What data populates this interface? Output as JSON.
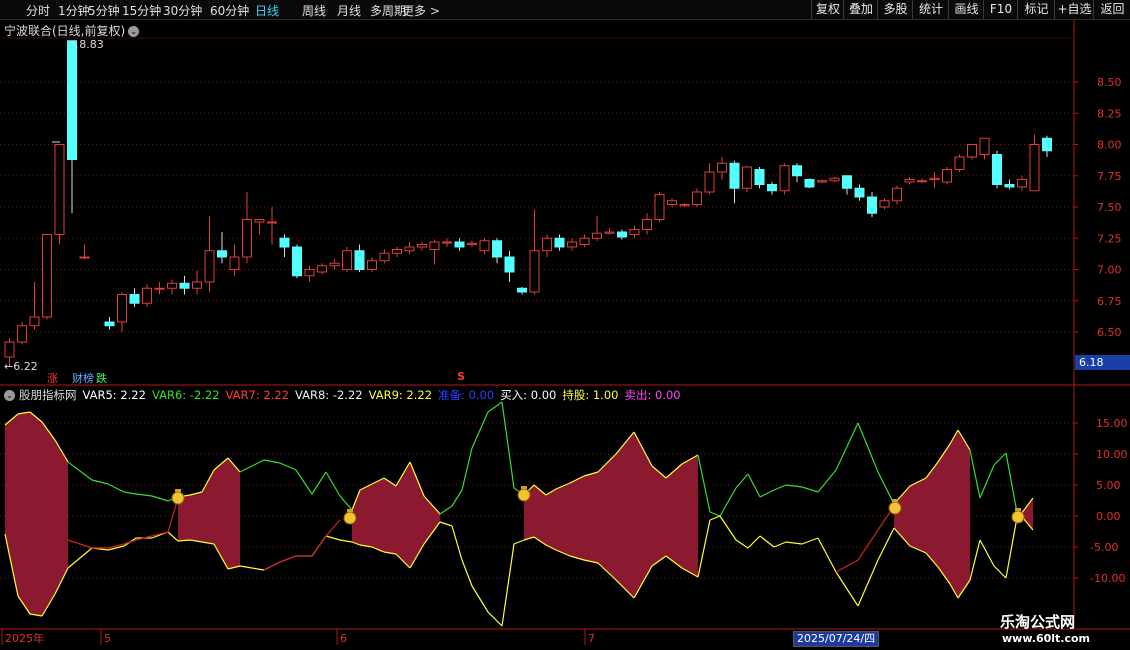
{
  "toolbar": {
    "periods": [
      "分时",
      "1分钟",
      "5分钟",
      "15分钟",
      "30分钟",
      "60分钟",
      "日线",
      "周线",
      "月线",
      "多周期",
      "更多 >"
    ],
    "active_period": "日线",
    "buttons": [
      "复权",
      "叠加",
      "多股",
      "统计",
      "画线",
      "F10",
      "标记",
      "+自选",
      "返回"
    ]
  },
  "stock": {
    "title": "宁波联合(日线,前复权)",
    "high_label": "8.83",
    "low_label": "6.22",
    "current_price": "6.18",
    "markers": {
      "zhang": "涨",
      "caibang": "财榜",
      "die": "跌",
      "s": "S"
    }
  },
  "indicator": {
    "name": "股朋指标网",
    "items": [
      {
        "label": "VAR5: 2.22",
        "color": "#ffffff"
      },
      {
        "label": "VAR6: -2.22",
        "color": "#2ee62e"
      },
      {
        "label": "VAR7: 2.22",
        "color": "#ff3a3a"
      },
      {
        "label": "VAR8: -2.22",
        "color": "#f0f0f0"
      },
      {
        "label": "VAR9: 2.22",
        "color": "#ffff44"
      },
      {
        "label": "准备: 0.00",
        "color": "#2a3fff"
      },
      {
        "label": "买入: 0.00",
        "color": "#ffffff"
      },
      {
        "label": "持股: 1.00",
        "color": "#ffff44"
      },
      {
        "label": "卖出: 0.00",
        "color": "#ff44ff"
      }
    ]
  },
  "price_axis": [
    "8.50",
    "8.25",
    "8.00",
    "7.75",
    "7.50",
    "7.25",
    "7.00",
    "6.75",
    "6.50"
  ],
  "ind_axis": [
    "15.00",
    "10.00",
    "5.00",
    "0.00",
    "-5.00",
    "-10.00"
  ],
  "date_axis": {
    "labels": [
      "2025年",
      "5",
      "6",
      "7"
    ],
    "cursor_date": "2025/07/24/四"
  },
  "watermark": {
    "name": "乐淘公式网",
    "url": "www.60lt.com"
  },
  "colors": {
    "up": "#e23c3c",
    "down": "#54ffff",
    "fill": "#8b1a30",
    "grid": "#7a1414"
  },
  "chart_data": {
    "type": "candlestick",
    "title": "宁波联合(日线,前复权)",
    "ylim": [
      6.2,
      8.9
    ],
    "candles": [
      [
        6.3,
        6.42,
        6.22,
        6.45
      ],
      [
        6.42,
        6.55,
        6.4,
        6.58
      ],
      [
        6.55,
        6.62,
        6.52,
        6.9
      ],
      [
        6.62,
        7.28,
        6.6,
        7.28
      ],
      [
        7.28,
        8.0,
        7.2,
        8.0
      ],
      [
        8.83,
        7.88,
        7.45,
        8.83
      ],
      [
        7.1,
        7.1,
        7.08,
        7.2
      ],
      null,
      [
        6.58,
        6.55,
        6.52,
        6.62
      ],
      [
        6.58,
        6.8,
        6.5,
        6.82
      ],
      [
        6.8,
        6.73,
        6.7,
        6.85
      ],
      [
        6.73,
        6.85,
        6.7,
        6.88
      ],
      [
        6.85,
        6.85,
        6.8,
        6.9
      ],
      [
        6.85,
        6.89,
        6.8,
        6.92
      ],
      [
        6.89,
        6.85,
        6.8,
        6.95
      ],
      [
        6.85,
        6.9,
        6.8,
        6.99
      ],
      [
        6.9,
        7.15,
        6.82,
        7.43
      ],
      [
        7.15,
        7.1,
        7.05,
        7.3
      ],
      [
        7.0,
        7.1,
        6.95,
        7.2
      ],
      [
        7.1,
        7.4,
        7.05,
        7.62
      ],
      [
        7.38,
        7.4,
        7.28,
        7.4
      ],
      [
        7.38,
        7.38,
        7.2,
        7.5
      ],
      [
        7.25,
        7.18,
        7.1,
        7.28
      ],
      [
        7.18,
        6.95,
        6.93,
        7.2
      ],
      [
        6.95,
        7.0,
        6.9,
        7.03
      ],
      [
        6.98,
        7.03,
        6.96,
        7.05
      ],
      [
        7.03,
        7.05,
        7.0,
        7.08
      ],
      [
        7.0,
        7.15,
        6.98,
        7.18
      ],
      [
        7.15,
        7.0,
        6.98,
        7.2
      ],
      [
        7.0,
        7.07,
        6.98,
        7.1
      ],
      [
        7.07,
        7.13,
        7.05,
        7.16
      ],
      [
        7.13,
        7.16,
        7.1,
        7.18
      ],
      [
        7.15,
        7.18,
        7.12,
        7.22
      ],
      [
        7.18,
        7.2,
        7.15,
        7.22
      ],
      [
        7.16,
        7.22,
        7.04,
        7.24
      ],
      [
        7.22,
        7.22,
        7.18,
        7.25
      ],
      [
        7.22,
        7.18,
        7.15,
        7.25
      ],
      [
        7.2,
        7.21,
        7.18,
        7.23
      ],
      [
        7.15,
        7.23,
        7.12,
        7.25
      ],
      [
        7.23,
        7.1,
        7.05,
        7.25
      ],
      [
        7.1,
        6.98,
        6.9,
        7.15
      ],
      [
        6.85,
        6.82,
        6.8,
        6.86
      ],
      [
        6.82,
        7.15,
        6.8,
        7.48
      ],
      [
        7.15,
        7.25,
        7.1,
        7.28
      ],
      [
        7.25,
        7.18,
        7.15,
        7.28
      ],
      [
        7.18,
        7.22,
        7.15,
        7.25
      ],
      [
        7.2,
        7.25,
        7.18,
        7.28
      ],
      [
        7.25,
        7.29,
        7.23,
        7.43
      ],
      [
        7.29,
        7.3,
        7.28,
        7.33
      ],
      [
        7.3,
        7.26,
        7.24,
        7.32
      ],
      [
        7.28,
        7.32,
        7.25,
        7.35
      ],
      [
        7.32,
        7.4,
        7.28,
        7.45
      ],
      [
        7.4,
        7.6,
        7.38,
        7.62
      ],
      [
        7.52,
        7.55,
        7.5,
        7.57
      ],
      [
        7.51,
        7.52,
        7.5,
        7.53
      ],
      [
        7.52,
        7.62,
        7.5,
        7.65
      ],
      [
        7.62,
        7.78,
        7.6,
        7.85
      ],
      [
        7.78,
        7.85,
        7.72,
        7.9
      ],
      [
        7.85,
        7.65,
        7.53,
        7.87
      ],
      [
        7.65,
        7.82,
        7.62,
        7.83
      ],
      [
        7.8,
        7.68,
        7.65,
        7.82
      ],
      [
        7.68,
        7.63,
        7.6,
        7.7
      ],
      [
        7.63,
        7.83,
        7.6,
        7.85
      ],
      [
        7.83,
        7.75,
        7.7,
        7.85
      ],
      [
        7.72,
        7.66,
        7.65,
        7.73
      ],
      [
        7.7,
        7.71,
        7.69,
        7.72
      ],
      [
        7.71,
        7.73,
        7.7,
        7.74
      ],
      [
        7.75,
        7.65,
        7.6,
        7.75
      ],
      [
        7.65,
        7.58,
        7.55,
        7.68
      ],
      [
        7.58,
        7.45,
        7.42,
        7.62
      ],
      [
        7.5,
        7.55,
        7.48,
        7.57
      ],
      [
        7.55,
        7.65,
        7.52,
        7.67
      ],
      [
        7.7,
        7.72,
        7.68,
        7.74
      ],
      [
        7.71,
        7.71,
        7.69,
        7.73
      ],
      [
        7.72,
        7.73,
        7.65,
        7.78
      ],
      [
        7.7,
        7.8,
        7.68,
        7.82
      ],
      [
        7.8,
        7.9,
        7.78,
        7.92
      ],
      [
        7.9,
        8.0,
        7.88,
        8.0
      ],
      [
        7.92,
        8.05,
        7.88,
        8.05
      ],
      [
        7.92,
        7.68,
        7.65,
        7.95
      ],
      [
        7.68,
        7.66,
        7.64,
        7.72
      ],
      [
        7.66,
        7.72,
        7.63,
        7.75
      ],
      [
        7.63,
        8.0,
        7.63,
        8.08
      ],
      [
        8.05,
        7.95,
        7.9,
        8.07
      ]
    ]
  }
}
